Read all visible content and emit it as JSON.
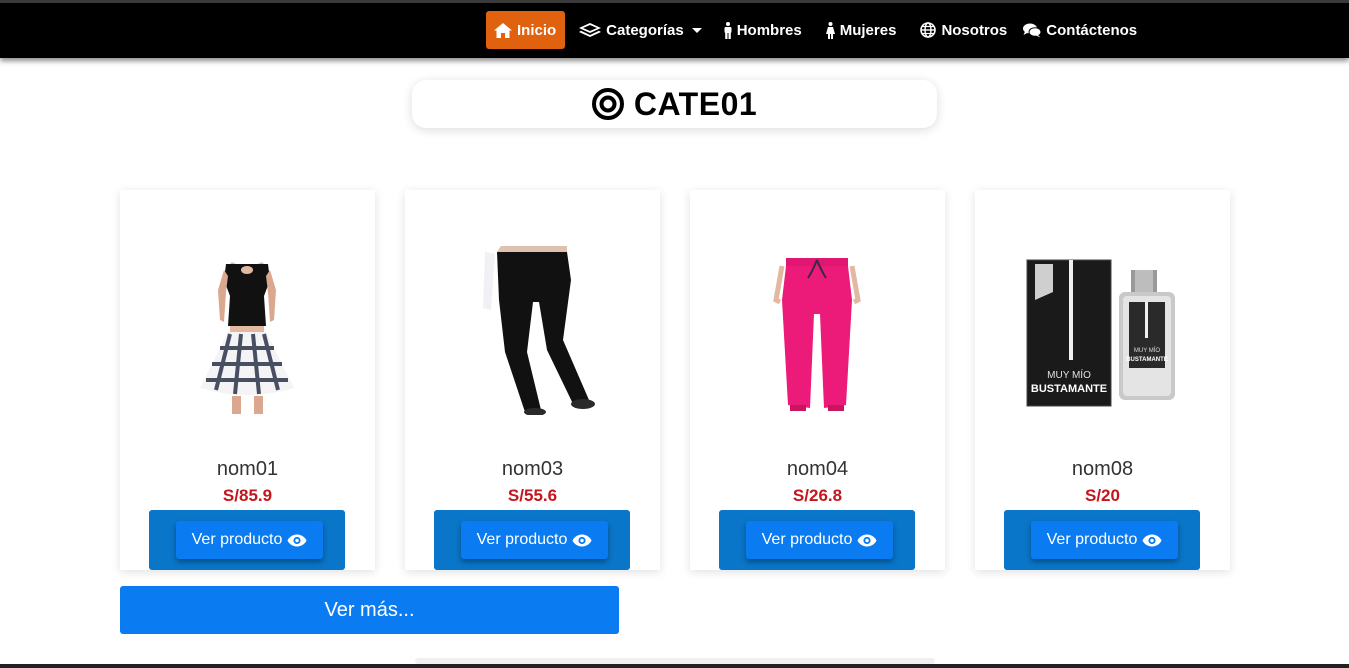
{
  "nav": {
    "items": [
      {
        "label": "Inicio",
        "icon": "home-icon",
        "active": true
      },
      {
        "label": "Categorías",
        "icon": "layers-icon",
        "dropdown": true
      },
      {
        "label": "Hombres",
        "icon": "male-icon"
      },
      {
        "label": "Mujeres",
        "icon": "female-icon"
      },
      {
        "label": "Nosotros",
        "icon": "globe-icon"
      },
      {
        "label": "Contáctenos",
        "icon": "chat-icon"
      }
    ]
  },
  "page": {
    "title": "CATE01",
    "title_icon": "target-icon"
  },
  "products": [
    {
      "name": "nom01",
      "price": "S/85.9",
      "image": "skirt-outfit-image",
      "button_label": "Ver producto"
    },
    {
      "name": "nom03",
      "price": "S/55.6",
      "image": "black-jeans-image",
      "button_label": "Ver producto"
    },
    {
      "name": "nom04",
      "price": "S/26.8",
      "image": "pink-pants-image",
      "button_label": "Ver producto"
    },
    {
      "name": "nom08",
      "price": "S/20",
      "image": "perfume-bottle-image",
      "button_label": "Ver producto",
      "image_text": [
        "MUY MÍO",
        "BUSTAMANTE"
      ]
    }
  ],
  "more_button": "Ver más...",
  "colors": {
    "navbar": "#000000",
    "active_nav": "#e0620f",
    "price": "#c4161c",
    "button": "#0a7bf1",
    "card_footer": "#0a76c9"
  }
}
